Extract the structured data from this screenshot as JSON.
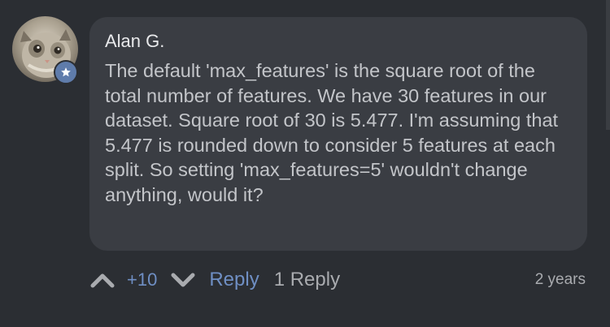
{
  "comment": {
    "author": "Alan G.",
    "text": "The default 'max_features' is the square root of the total number of features. We have 30 features in our dataset. Square root of 30 is 5.477. I'm assuming that 5.477 is rounded down to consider 5 features at each split. So setting 'max_features=5' wouldn't change anything, would it?",
    "badge_icon": "star-icon"
  },
  "actions": {
    "upvote_icon": "chevron-up-icon",
    "score": "+10",
    "downvote_icon": "chevron-down-icon",
    "reply_label": "Reply",
    "replies_label": "1 Reply"
  },
  "timestamp": "2 years",
  "colors": {
    "background": "#2b2e33",
    "bubble": "#3a3d43",
    "accent": "#6f8fc4",
    "badge": "#5f7cab",
    "muted_text": "#a9abaf"
  }
}
